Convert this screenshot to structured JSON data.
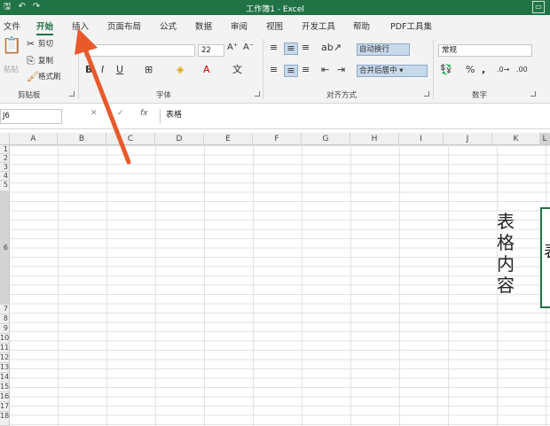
{
  "titlebar": {
    "title": "工作簿1 - Excel"
  },
  "tabs": [
    "文件",
    "开始",
    "插入",
    "页面布局",
    "公式",
    "数据",
    "审阅",
    "视图",
    "开发工具",
    "帮助",
    "PDF工具集"
  ],
  "ribbon": {
    "clipboard": {
      "paste": "粘贴",
      "cut": "剪切",
      "copy": "复制",
      "format_painter": "格式刷",
      "label": "剪贴板"
    },
    "font": {
      "size": "22",
      "label": "字体"
    },
    "alignment": {
      "wrap": "自动换行",
      "merge": "合并后居中",
      "label": "对齐方式"
    },
    "number": {
      "format": "常规",
      "label": "数字"
    }
  },
  "formula_bar": {
    "namebox": "J6",
    "fx": "fx",
    "cancel": "✕",
    "confirm": "✓",
    "content": "表格"
  },
  "columns": [
    "A",
    "B",
    "C",
    "D",
    "E",
    "F",
    "G",
    "H",
    "I",
    "J",
    "K",
    "L"
  ],
  "rows": [
    "1",
    "2",
    "3",
    "4",
    "5",
    "6",
    "7",
    "8",
    "9",
    "10",
    "11",
    "12",
    "13",
    "14",
    "15",
    "16",
    "17",
    "18"
  ],
  "cells": {
    "K_vertical": "表\n格\n内\n容",
    "L_partial": "表"
  },
  "colors": {
    "accent": "#217346",
    "arrow": "#e85a2b"
  }
}
